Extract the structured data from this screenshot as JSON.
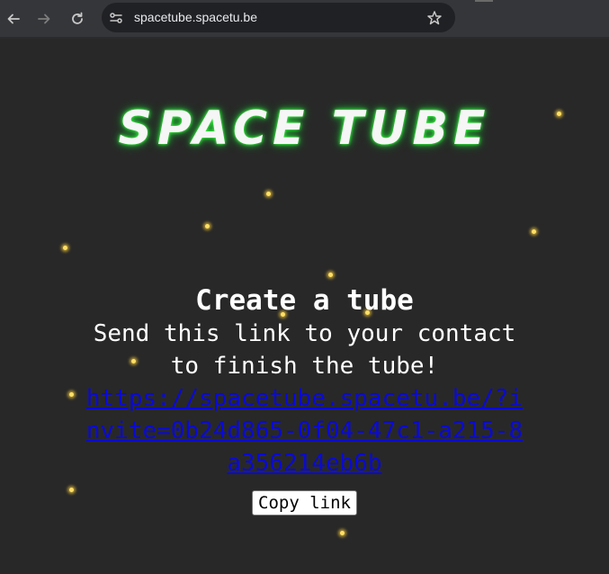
{
  "browser": {
    "url": "spacetube.spacetu.be",
    "icons": [
      "back-arrow-icon",
      "forward-arrow-icon",
      "reload-icon",
      "site-info-icon",
      "bookmark-star-icon"
    ]
  },
  "page": {
    "logo_text": "SPACE TUBE",
    "title": "Create a tube",
    "message_line1": "Send this link to your contact",
    "message_line2": "to finish the tube!",
    "invite_link": "https://spacetube.spacetu.be/?invite=0b24d865-0f04-47c1-a215-8a356214eb6b",
    "copy_button": "Copy link"
  },
  "colors": {
    "background": "#282828",
    "link": "#0a0ad4",
    "logo_glow": "#2ecc40",
    "stars": "#ffe066"
  }
}
